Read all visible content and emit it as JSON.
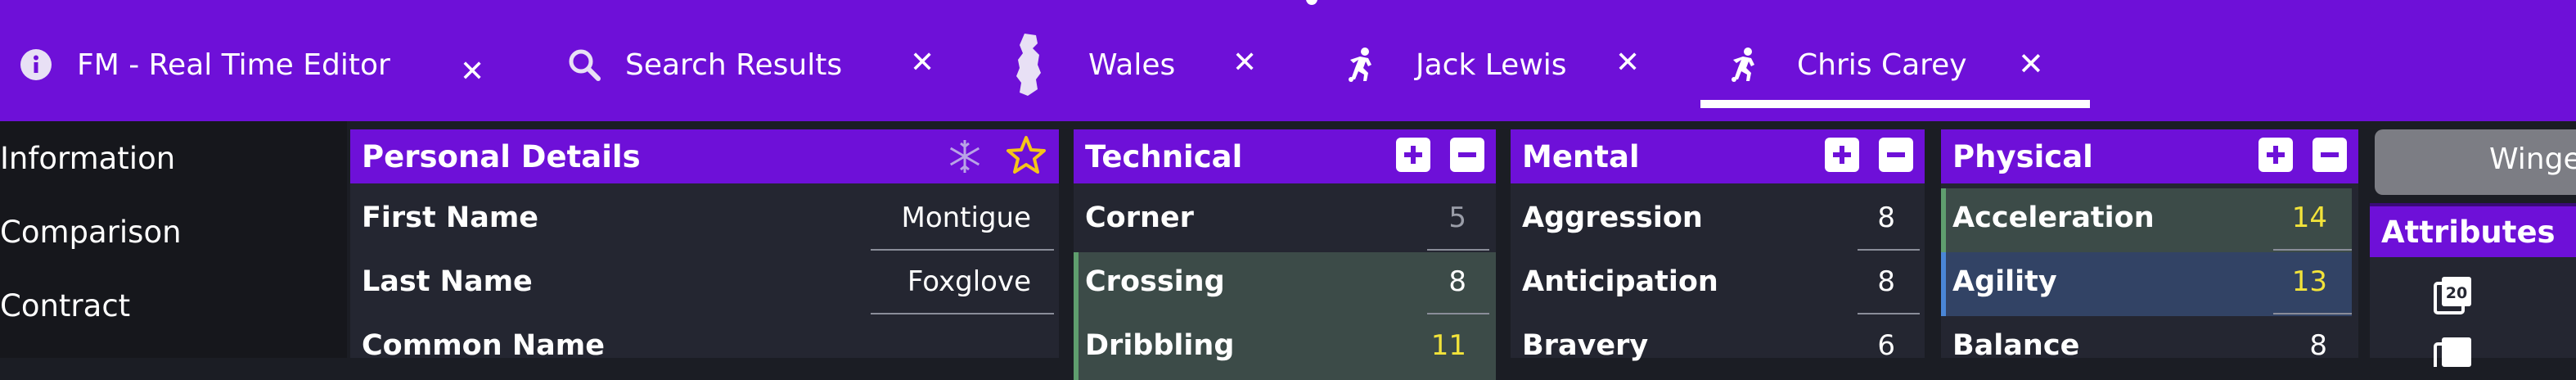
{
  "tabs": [
    {
      "label": "FM - Real Time Editor",
      "icon": "info-icon",
      "active": false
    },
    {
      "label": "Search Results",
      "icon": "search-icon",
      "active": false
    },
    {
      "label": "Wales",
      "icon": "wales-map-icon",
      "active": false
    },
    {
      "label": "Jack Lewis",
      "icon": "player-icon",
      "active": false
    },
    {
      "label": "Chris Carey",
      "icon": "player-icon",
      "active": true
    }
  ],
  "tab_close_glyph": "✕",
  "sidebar": {
    "items": [
      {
        "label": "Information"
      },
      {
        "label": "Comparison"
      },
      {
        "label": "Contract"
      }
    ]
  },
  "personal_details": {
    "title": "Personal Details",
    "rows": [
      {
        "label": "First Name",
        "value": "Montigue"
      },
      {
        "label": "Last Name",
        "value": "Foxglove"
      },
      {
        "label": "Common Name",
        "value": ""
      }
    ]
  },
  "technical": {
    "title": "Technical",
    "rows": [
      {
        "label": "Corner",
        "value": "5"
      },
      {
        "label": "Crossing",
        "value": "8"
      },
      {
        "label": "Dribbling",
        "value": "11"
      }
    ]
  },
  "mental": {
    "title": "Mental",
    "rows": [
      {
        "label": "Aggression",
        "value": "8"
      },
      {
        "label": "Anticipation",
        "value": "8"
      },
      {
        "label": "Bravery",
        "value": "6"
      }
    ]
  },
  "physical": {
    "title": "Physical",
    "rows": [
      {
        "label": "Acceleration",
        "value": "14"
      },
      {
        "label": "Agility",
        "value": "13"
      },
      {
        "label": "Balance",
        "value": "8"
      }
    ]
  },
  "right_panel": {
    "button_label": "Winger",
    "attributes_title": "Attributes"
  },
  "colors": {
    "brand_purple": "#6e10d8",
    "panel_bg": "#242631",
    "star": "#f5c518",
    "value_yellow": "#f2e33a",
    "value_muted": "#9a9da8"
  }
}
